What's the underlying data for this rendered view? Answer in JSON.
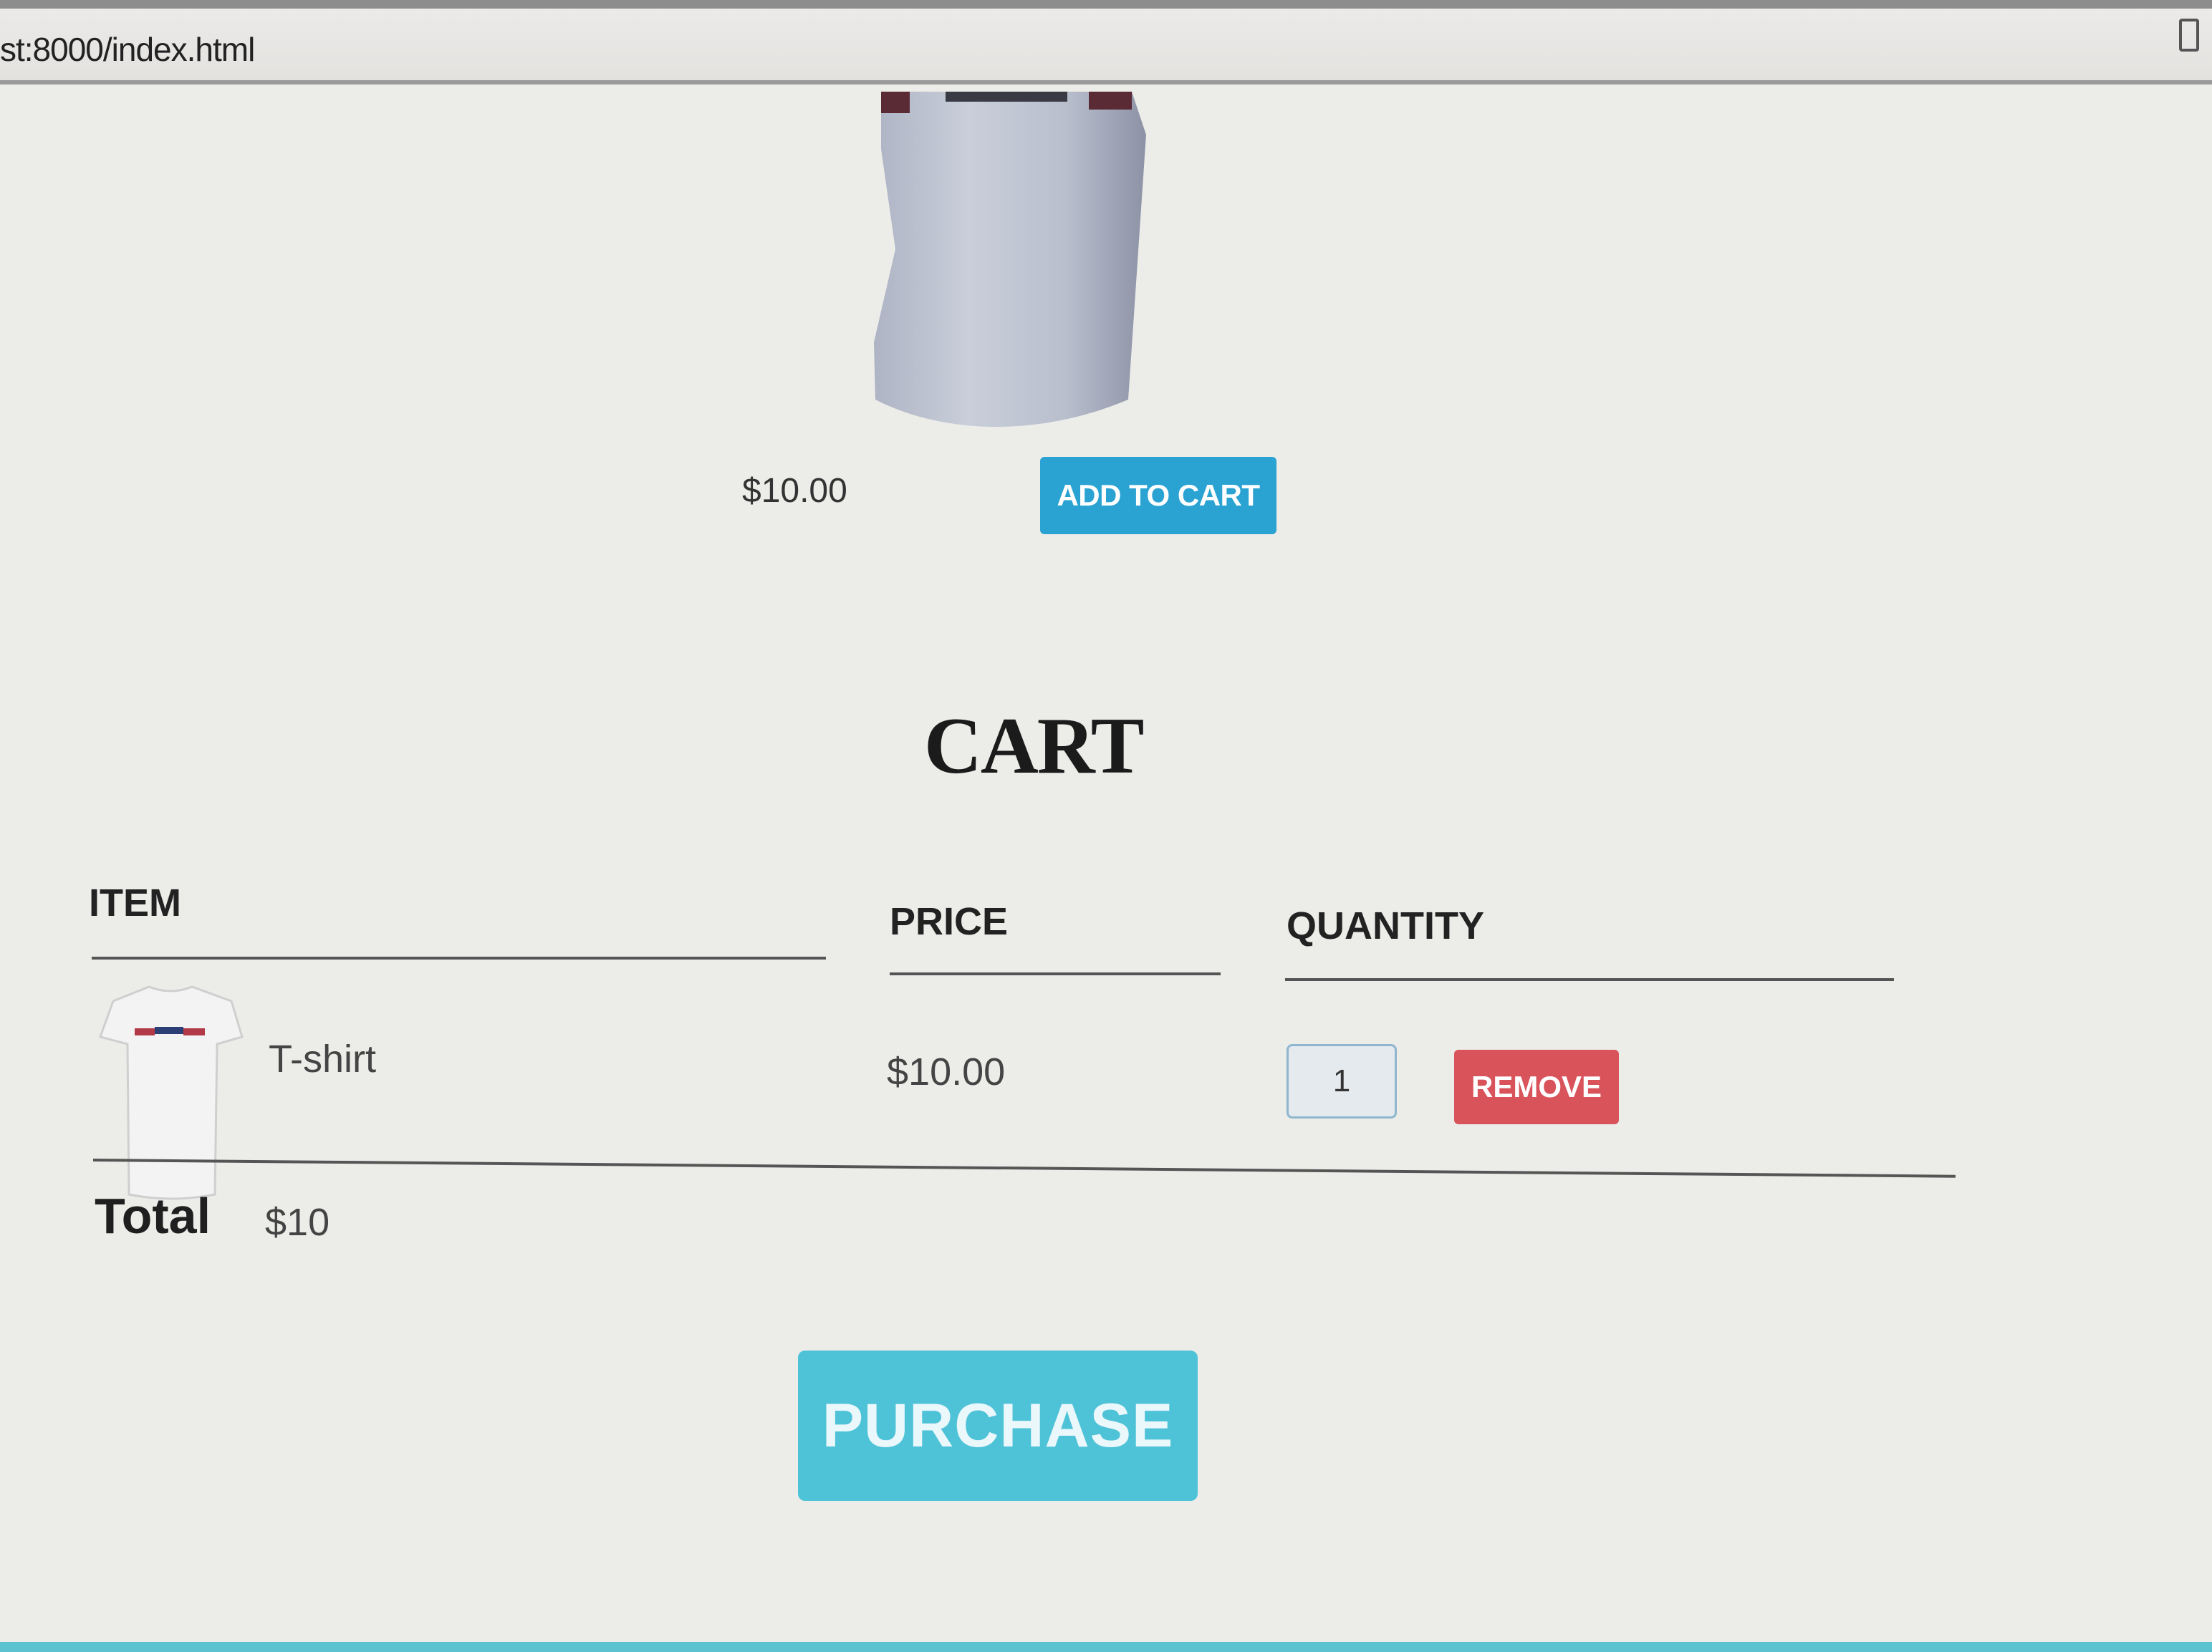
{
  "browser": {
    "url": "st:8000/index.html",
    "extension_icon": "sidebar-icon"
  },
  "product": {
    "image": "tshirt-image",
    "price": "$10.00",
    "add_to_cart_label": "ADD TO CART"
  },
  "cart": {
    "title": "CART",
    "columns": [
      "ITEM",
      "PRICE",
      "QUANTITY"
    ],
    "items": [
      {
        "name": "T-shirt",
        "price": "$10.00",
        "quantity": "1",
        "thumb": "tshirt-thumbnail",
        "remove_label": "REMOVE"
      }
    ],
    "total_label": "Total",
    "total_value": "$10",
    "purchase_label": "PURCHASE"
  },
  "colors": {
    "add_to_cart": "#2aa3d3",
    "remove": "#d9535b",
    "purchase": "#4ec3d8"
  }
}
